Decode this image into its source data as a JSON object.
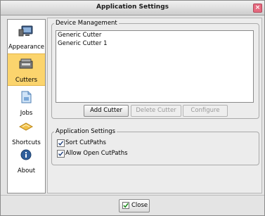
{
  "window": {
    "title": "Application Settings"
  },
  "sidebar": {
    "items": [
      {
        "label": "Appearance",
        "icon": "monitor-icon",
        "selected": false
      },
      {
        "label": "Cutters",
        "icon": "cutter-icon",
        "selected": true
      },
      {
        "label": "Jobs",
        "icon": "document-icon",
        "selected": false
      },
      {
        "label": "Shortcuts",
        "icon": "keyboard-icon",
        "selected": false
      },
      {
        "label": "About",
        "icon": "info-icon",
        "selected": false
      }
    ]
  },
  "device_management": {
    "title": "Device Management",
    "devices": [
      "Generic Cutter",
      "Generic Cutter 1"
    ],
    "add_label": "Add Cutter",
    "delete_label": "Delete Cutter",
    "configure_label": "Configure"
  },
  "application_settings": {
    "title": "Application Settings",
    "options": [
      {
        "label": "Sort CutPaths",
        "checked": true
      },
      {
        "label": "Allow Open CutPaths",
        "checked": true
      }
    ]
  },
  "footer": {
    "close_label": "Close"
  },
  "colors": {
    "selected": "#fbd46d",
    "title_close": "#e56a7f"
  }
}
